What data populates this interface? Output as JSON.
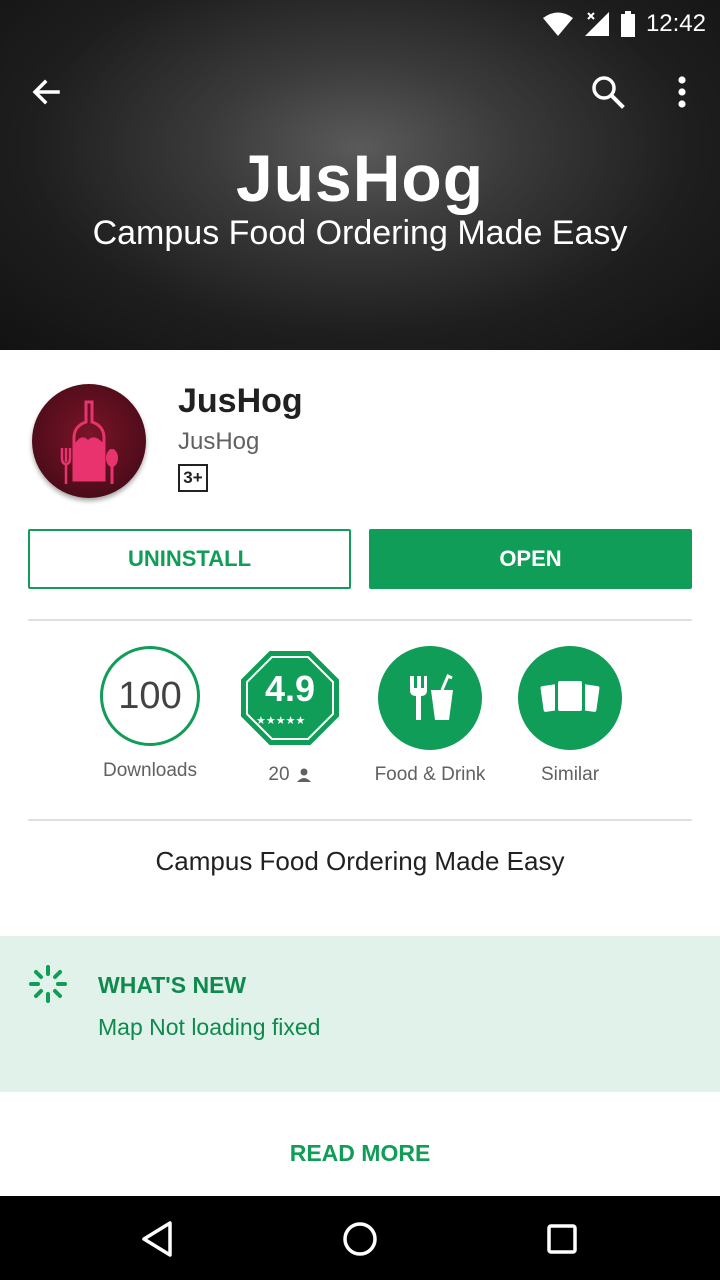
{
  "status_bar": {
    "time": "12:42",
    "icons": [
      "wifi-icon",
      "signal-icon",
      "battery-icon"
    ]
  },
  "hero": {
    "title": "JusHog",
    "subtitle": "Campus Food Ordering Made Easy"
  },
  "app": {
    "name": "JusHog",
    "developer": "JusHog",
    "content_rating": "3+"
  },
  "actions": {
    "uninstall_label": "UNINSTALL",
    "open_label": "OPEN"
  },
  "stats": {
    "downloads_value": "100",
    "downloads_label": "Downloads",
    "rating_value": "4.9",
    "rating_count": "20",
    "category_label": "Food & Drink",
    "similar_label": "Similar"
  },
  "tagline": "Campus Food Ordering Made Easy",
  "whats_new": {
    "title": "WHAT'S NEW",
    "text": "Map Not loading fixed"
  },
  "read_more_label": "READ MORE",
  "colors": {
    "accent": "#109d58",
    "whats_new_bg": "#e1f2ea",
    "app_icon": "#5a0e1e"
  }
}
